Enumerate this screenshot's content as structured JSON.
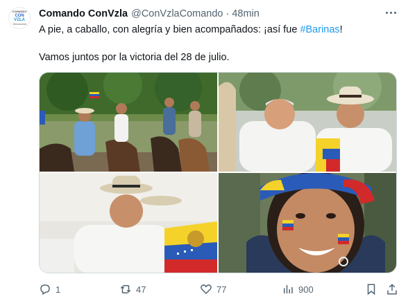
{
  "author": {
    "name": "Comando ConVzla",
    "handle": "@ConVzlaComando",
    "separator": "·",
    "time": "48min",
    "avatar_lines": [
      "COMANDO",
      "CON",
      "VZLA",
      "Venezuela"
    ]
  },
  "tweet": {
    "line1_prefix": "A pie, a caballo, con alegría y bien acompañados: ¡así fue ",
    "hashtag": "#Barinas",
    "line1_suffix": "!",
    "line2": "Vamos juntos por la victoria del 28 de julio."
  },
  "actions": {
    "replies": "1",
    "retweets": "47",
    "likes": "77",
    "views": "900"
  },
  "colors": {
    "accent": "#1d9bf0",
    "secondary_text": "#536471"
  }
}
